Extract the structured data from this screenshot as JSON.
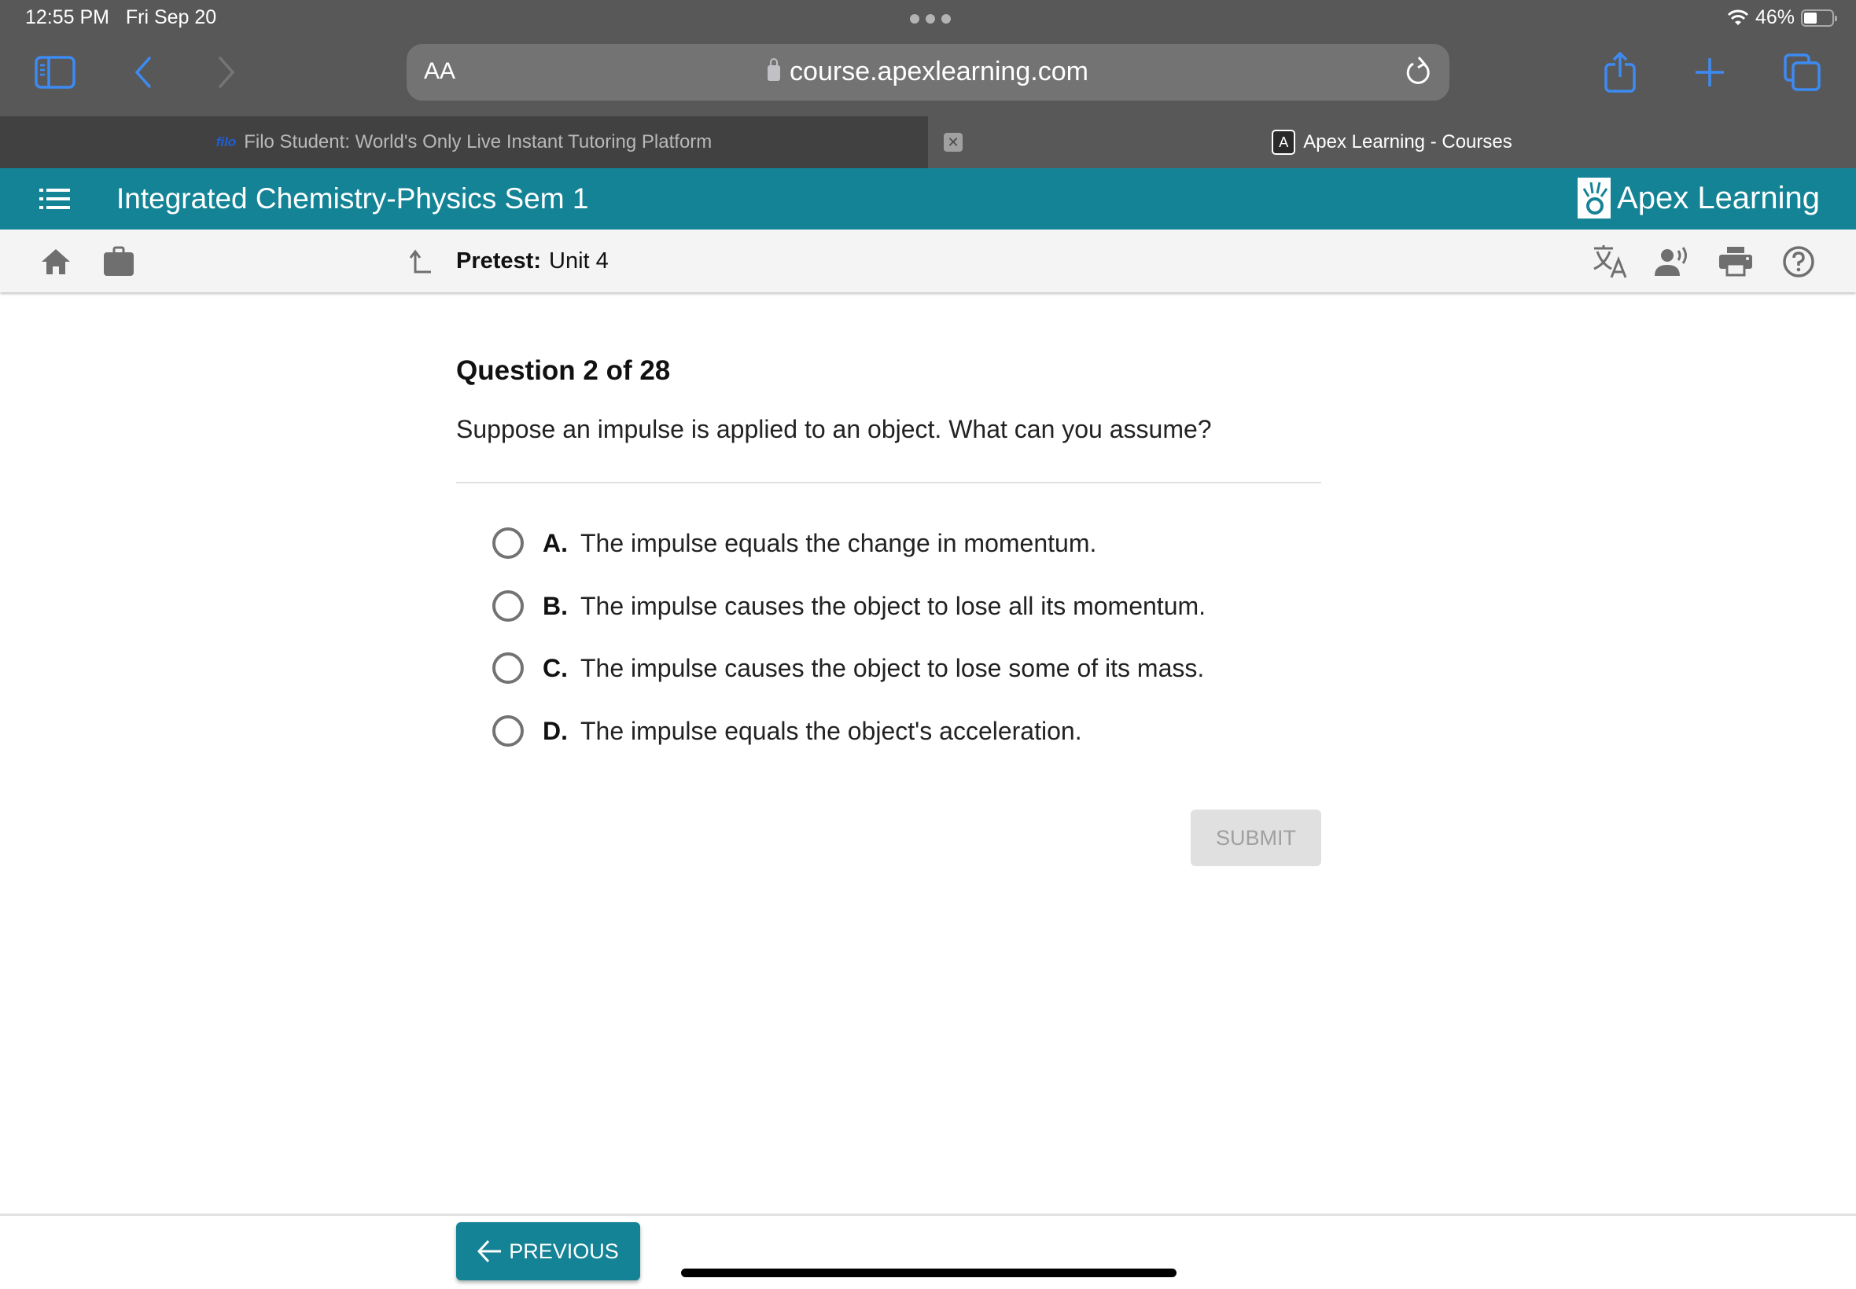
{
  "status_bar": {
    "time": "12:55 PM",
    "date": "Fri Sep 20",
    "battery_percent": "46%",
    "battery_level": 0.46
  },
  "browser": {
    "text_size_label": "AA",
    "url": "course.apexlearning.com",
    "icons": [
      "sidebar-icon",
      "back-icon",
      "forward-icon",
      "reload-icon",
      "share-icon",
      "new-tab-icon",
      "tabs-icon"
    ],
    "tabs": [
      {
        "favicon": "filo",
        "label": "Filo Student: World's Only Live Instant Tutoring Platform",
        "active": false
      },
      {
        "favicon": "A",
        "label": "Apex Learning - Courses",
        "active": true
      }
    ],
    "close_tab_label": "✕"
  },
  "app": {
    "course_title": "Integrated Chemistry-Physics Sem 1",
    "brand": "Apex Learning",
    "brand_color": "#148396"
  },
  "subnav": {
    "assessment_type": "Pretest:",
    "assessment_name": "Unit 4",
    "left_icons": [
      "home-icon",
      "briefcase-icon",
      "up-level-icon"
    ],
    "right_icons": [
      "translate-icon",
      "text-to-speech-icon",
      "print-icon",
      "help-icon"
    ]
  },
  "question": {
    "counter": "Question 2 of 28",
    "prompt": "Suppose an impulse is applied to an object. What can you assume?",
    "options": [
      {
        "letter": "A.",
        "text": "The impulse equals the change in momentum."
      },
      {
        "letter": "B.",
        "text": "The impulse causes the object to lose all its momentum."
      },
      {
        "letter": "C.",
        "text": "The impulse causes the object to lose some of its mass."
      },
      {
        "letter": "D.",
        "text": "The impulse equals the object's acceleration."
      }
    ],
    "submit_label": "SUBMIT"
  },
  "footer": {
    "previous_label": "PREVIOUS"
  }
}
